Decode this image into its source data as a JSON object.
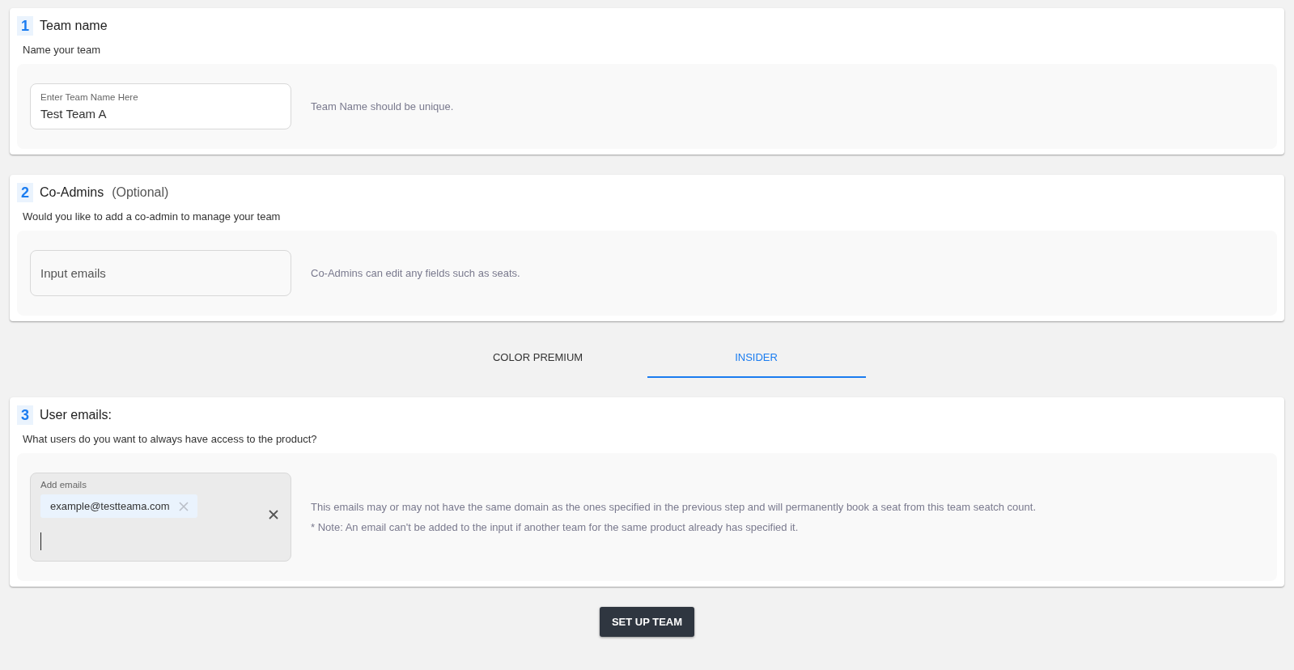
{
  "sections_top": [
    {
      "number": "1",
      "title": "Team name",
      "subtitle": "Name your team",
      "field": {
        "kind": "text",
        "label": "Enter Team Name Here",
        "value": "Test Team A"
      },
      "hints": [
        "Team Name should be unique."
      ]
    },
    {
      "number": "2",
      "title": "Co-Admins",
      "optional": "(Optional)",
      "subtitle": "Would you like to add a co-admin to manage your team",
      "field": {
        "kind": "email",
        "placeholder": "Input emails"
      },
      "hints": [
        "Co-Admins can edit any fields such as seats."
      ]
    }
  ],
  "tabs": [
    {
      "label": "COLOR PREMIUM",
      "selected": false
    },
    {
      "label": "INSIDER",
      "selected": true
    }
  ],
  "sections_bottom": [
    {
      "number": "3",
      "title": "User emails:",
      "subtitle": "What users do you want to always have access to the product?",
      "field": {
        "kind": "chips",
        "label": "Add emails",
        "chips": [
          "example@testteama.com"
        ]
      },
      "hints": [
        "This emails may or may not have the same domain as the ones specified in the previous step and will permanently book a seat from this team seatch count.",
        "* Note: An email can't be added to the input if another team for the same product already has specified it."
      ]
    }
  ],
  "submit": "SET UP TEAM"
}
